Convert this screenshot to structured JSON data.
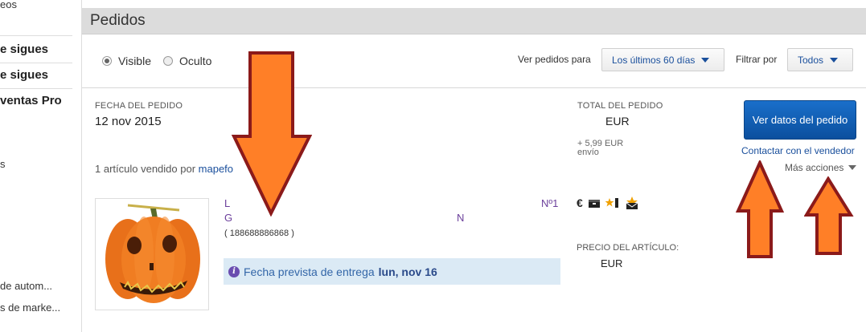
{
  "sidebar": {
    "items": [
      {
        "label": "eos",
        "bold": false
      },
      {
        "label": "e sigues",
        "bold": true
      },
      {
        "label": "e sigues",
        "bold": true
      },
      {
        "label": "ventas Pro",
        "bold": true
      },
      {
        "label": "s",
        "bold": false
      },
      {
        "label": "de autom...",
        "bold": false
      },
      {
        "label": "s de marke...",
        "bold": false
      }
    ]
  },
  "header": {
    "title": "Pedidos"
  },
  "filters": {
    "visible_label": "Visible",
    "hidden_label": "Oculto",
    "view_orders_label": "Ver pedidos para",
    "period_value": "Los últimos 60 días",
    "filter_by_label": "Filtrar por",
    "filter_value": "Todos"
  },
  "order": {
    "date_label": "FECHA DEL PEDIDO",
    "date_value": "12 nov 2015",
    "total_label": "TOTAL DEL PEDIDO",
    "total_currency": "EUR",
    "shipping": "+ 5,99 EUR",
    "shipping_label": "envío",
    "sold_by_prefix": "1 artículo vendido por",
    "seller": "mapefo",
    "view_details_button": "Ver datos del pedido",
    "contact_seller_link": "Contactar con el vendedor",
    "more_actions": "Más acciones",
    "item": {
      "title_line1": "L",
      "title_line2": "G",
      "title_line2_end": "N",
      "number_label": "Nº1",
      "item_id": "( 188688886868 )",
      "delivery_prefix": "Fecha prevista de entrega",
      "delivery_date": "lun, nov 16",
      "price_label": "PRECIO DEL ARTÍCULO:",
      "price_currency": "EUR"
    },
    "status_icons": [
      "euro-icon",
      "package-icon",
      "feedback-star-icon",
      "positive-feedback-icon"
    ]
  },
  "colors": {
    "arrow_fill": "#ff7f27",
    "arrow_stroke": "#8b1a1a",
    "button_blue": "#0b5cb5",
    "link_blue": "#1a4f9c",
    "delivery_bg": "#dbeaf5"
  }
}
